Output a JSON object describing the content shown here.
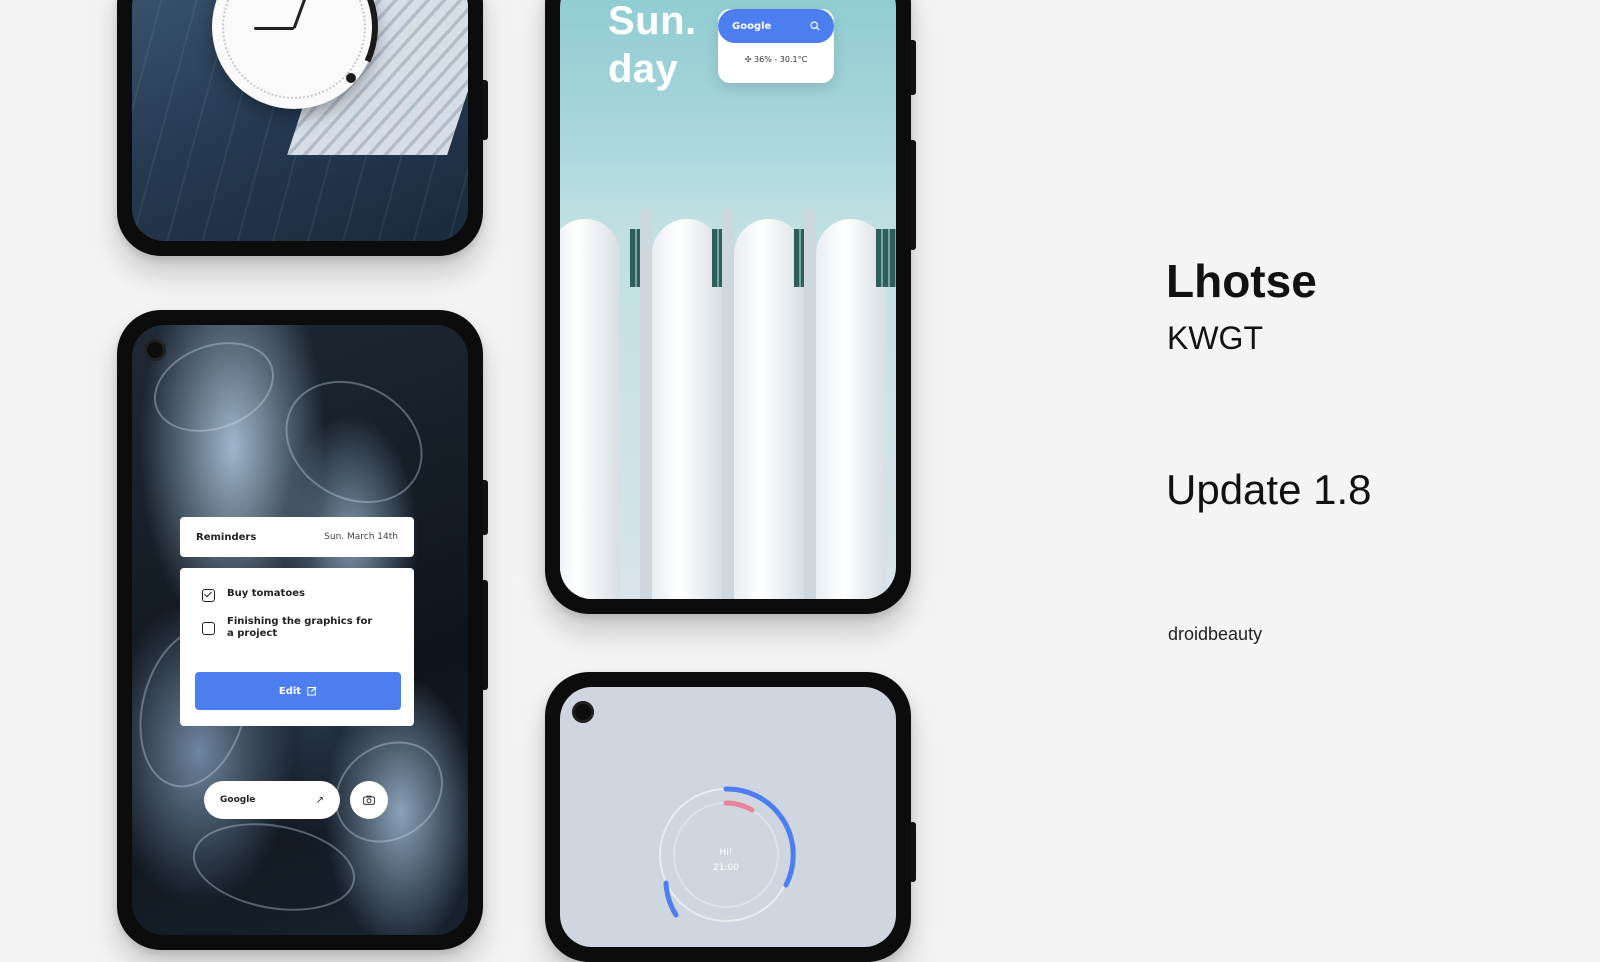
{
  "brand": {
    "title": "Lhotse",
    "subtitle": "KWGT",
    "update": "Update 1.8",
    "author": "droidbeauty"
  },
  "reminders_phone": {
    "header_title": "Reminders",
    "header_date": "Sun. March 14th",
    "items": [
      {
        "label": "Buy tomatoes",
        "checked": true
      },
      {
        "label": "Finishing the graphics for a project",
        "checked": false
      }
    ],
    "edit_label": "Edit",
    "search_label": "Google",
    "search_arrow": "↗"
  },
  "sunday_phone": {
    "day_line1": "Sun.",
    "day_line2": "day",
    "search_label": "Google",
    "weather": "36% - 30.1°C"
  },
  "ring_phone": {
    "greeting": "Hi!",
    "time": "21:00"
  },
  "colors": {
    "accent": "#4d7ef0",
    "ring_pink": "#e8839c"
  },
  "icons": [
    "search-icon",
    "edit-icon",
    "camera-icon",
    "arrow-up-right-icon",
    "weather-icon",
    "checkbox-icon"
  ]
}
